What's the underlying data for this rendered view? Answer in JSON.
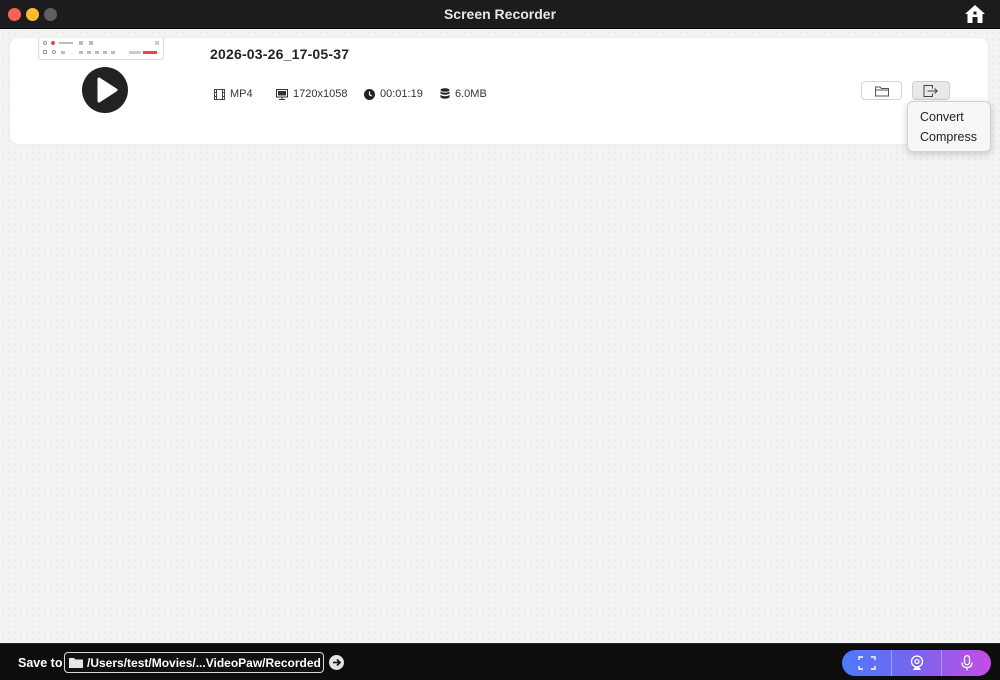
{
  "window": {
    "title": "Screen Recorder"
  },
  "icons": {
    "home": "home-icon",
    "play": "play-icon",
    "format": "film-icon",
    "resolution": "monitor-icon",
    "duration": "clock-icon",
    "size": "database-icon",
    "open_folder": "folder-icon",
    "export": "export-icon",
    "save_folder": "folder-icon",
    "go": "arrow-right-icon",
    "mode_screen": "fullscreen-icon",
    "mode_webcam": "webcam-icon",
    "mode_audio": "microphone-icon"
  },
  "recording": {
    "filename": "2026-03-26_17-05-37",
    "format": "MP4",
    "resolution": "1720x1058",
    "duration": "00:01:19",
    "size": "6.0MB"
  },
  "export_menu": {
    "items": [
      {
        "label": "Convert"
      },
      {
        "label": "Compress"
      }
    ]
  },
  "footer": {
    "save_label": "Save to",
    "path": "/Users/test/Movies/...VideoPaw/Recorded"
  },
  "colors": {
    "titlebar": "#1c1c1e",
    "close": "#fe5f57",
    "minimize": "#febc2e",
    "accent_start": "#4a7bff",
    "accent_end": "#c64de3"
  }
}
